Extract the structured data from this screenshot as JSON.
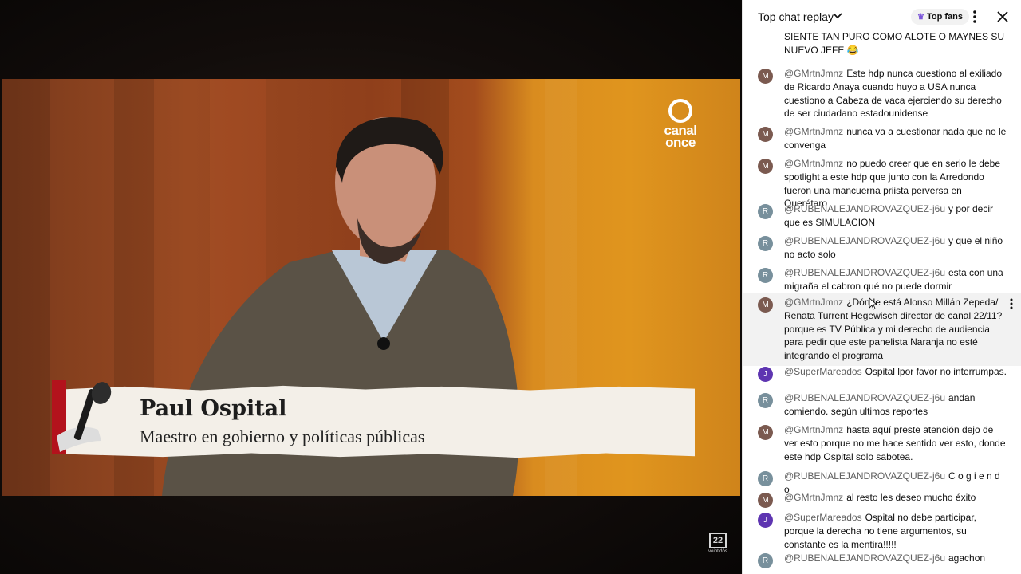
{
  "video": {
    "channel_logo_text": "canal once",
    "lower_third": {
      "name": "Paul Ospital",
      "role": "Maestro en gobierno y políticas públicas"
    },
    "watermark": {
      "mark": "22",
      "caption": "veintidós"
    }
  },
  "chat": {
    "header": {
      "title": "Top chat replay",
      "top_fans_label": "Top fans"
    },
    "messages": [
      {
        "initial": "",
        "color": "#ffffff",
        "author": "",
        "text": "SIENTE TAN PURO COMO ALOTE O MAYNES SU NUEVO JEFE 😂"
      },
      {
        "initial": "M",
        "color": "#7b5a50",
        "author": "@GMrtnJmnz",
        "text": "Este hdp nunca cuestiono al exiliado de Ricardo Anaya cuando huyo a USA nunca cuestiono a Cabeza de vaca ejerciendo su derecho de ser ciudadano estadounidense"
      },
      {
        "initial": "M",
        "color": "#7b5a50",
        "author": "@GMrtnJmnz",
        "text": "nunca va a cuestionar nada que no le convenga"
      },
      {
        "initial": "M",
        "color": "#7b5a50",
        "author": "@GMrtnJmnz",
        "text": "no puedo creer que en serio le debe spotlight a este hdp que junto con la Arredondo fueron una mancuerna priista perversa en Querétaro"
      },
      {
        "initial": "R",
        "color": "#78909c",
        "author": "@RUBENALEJANDROVAZQUEZ-j6u",
        "text": "y por decir que es SIMULACION"
      },
      {
        "initial": "R",
        "color": "#78909c",
        "author": "@RUBENALEJANDROVAZQUEZ-j6u",
        "text": "y que el niño no acto solo"
      },
      {
        "initial": "R",
        "color": "#78909c",
        "author": "@RUBENALEJANDROVAZQUEZ-j6u",
        "text": "esta con una migraña el cabron qué no puede dormir"
      },
      {
        "initial": "M",
        "color": "#7b5a50",
        "author": "@GMrtnJmnz",
        "text": "¿Dónde está Alonso Millán Zepeda/ Renata Turrent Hegewisch director de canal 22/11? porque es TV Pública y mi derecho de audiencia para pedir que este panelista Naranja no esté integrando el programa",
        "highlight": true
      },
      {
        "initial": "J",
        "color": "#5e35b1",
        "author": "@SuperMareados",
        "text": "Ospital lpor favor no interrumpas."
      },
      {
        "initial": "R",
        "color": "#78909c",
        "author": "@RUBENALEJANDROVAZQUEZ-j6u",
        "text": "andan comiendo. según ultimos reportes"
      },
      {
        "initial": "M",
        "color": "#7b5a50",
        "author": "@GMrtnJmnz",
        "text": "hasta aquí preste atención dejo de ver esto porque no me hace sentido ver esto, donde este hdp Ospital solo sabotea."
      },
      {
        "initial": "R",
        "color": "#78909c",
        "author": "@RUBENALEJANDROVAZQUEZ-j6u",
        "text": "C o g i e n d o"
      },
      {
        "initial": "M",
        "color": "#7b5a50",
        "author": "@GMrtnJmnz",
        "text": "al resto les deseo mucho éxito"
      },
      {
        "initial": "J",
        "color": "#5e35b1",
        "author": "@SuperMareados",
        "text": "Ospital no debe participar, porque la derecha no tiene argumentos, su constante es la mentira!!!!!"
      },
      {
        "initial": "R",
        "color": "#78909c",
        "author": "@RUBENALEJANDROVAZQUEZ-j6u",
        "text": "agachon"
      }
    ]
  }
}
